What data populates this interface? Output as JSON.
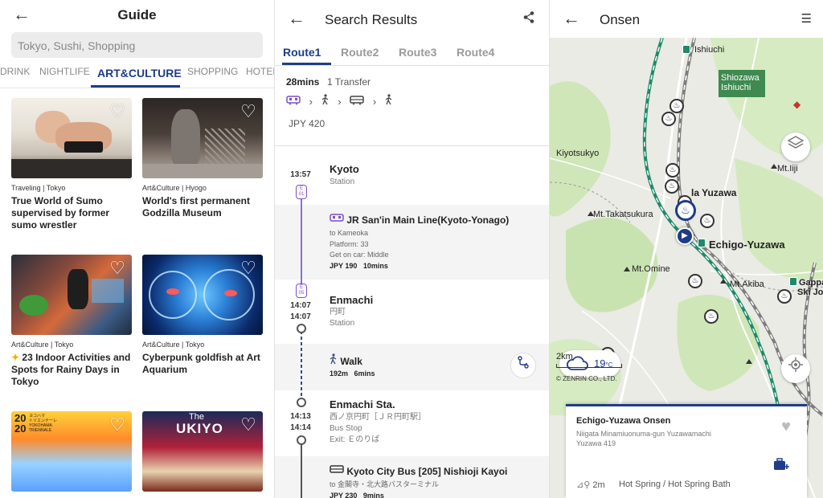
{
  "guide": {
    "title": "Guide",
    "search_placeholder": "Tokyo, Sushi, Shopping",
    "tabs": [
      "DRINK",
      "NIGHTLIFE",
      "ART&CULTURE",
      "SHOPPING",
      "HOTEL"
    ],
    "active_tab": "ART&CULTURE",
    "cards": [
      {
        "category": "Traveling | Tokyo",
        "title": "True World of Sumo supervised by former sumo wrestler"
      },
      {
        "category": "Art&Culture | Hyogo",
        "title": "World's first permanent Godzilla Museum"
      },
      {
        "category": "Art&Culture | Tokyo",
        "title_prefix": "✦",
        "title": "23 Indoor Activities and Spots for Rainy Days in Tokyo"
      },
      {
        "category": "Art&Culture | Tokyo",
        "title": "Cyberpunk goldfish at Art Aquarium"
      }
    ],
    "card_image_text": {
      "triennale": [
        "20",
        "20",
        "ヨコハマ",
        "トリエンナーレ",
        "YOKOHAMA",
        "TRIENNALE"
      ],
      "ukiyo": [
        "The",
        "UKIYO"
      ]
    }
  },
  "search": {
    "title": "Search Results",
    "routes": [
      "Route1",
      "Route2",
      "Route3",
      "Route4"
    ],
    "summary": {
      "duration": "28mins",
      "transfers": "1 Transfer",
      "fare": "JPY 420"
    },
    "stops": [
      {
        "time": "13:57",
        "name": "Kyoto",
        "type": "Station",
        "badge": [
          "E",
          "01"
        ]
      },
      {
        "time_arr": "14:07",
        "time_dep": "14:07",
        "name": "Enmachi",
        "name_jp": "円町",
        "type": "Station",
        "badge": [
          "E",
          "05"
        ]
      },
      {
        "time_arr": "14:13",
        "time_dep": "14:14",
        "name": "Enmachi Sta.",
        "name_jp": "西ノ京円町［ＪＲ円町駅］",
        "type": "Bus Stop",
        "exit": "Exit: Ｅのりば"
      }
    ],
    "segments": [
      {
        "title": "JR San'in Main Line(Kyoto-Yonago)",
        "to": "to Kameoka",
        "platform": "Platform: 33",
        "car": "Get on car: Middle",
        "fare": "JPY 190",
        "duration": "10mins"
      },
      {
        "title": "Walk",
        "distance": "192m",
        "duration": "6mins"
      },
      {
        "title": "Kyoto City Bus [205] Nishioji Kayoi",
        "to": "to 金閣寺・北大路バスターミナル",
        "fare": "JPY 230",
        "duration": "9mins"
      }
    ]
  },
  "map": {
    "title": "Onsen",
    "labels": [
      "Ishiuchi",
      "Shiozawa Ishiuchi",
      "Kiyotsukyo",
      "Mt.Iiji",
      "la Yuzawa",
      "Mt.Takatsukura",
      "Echigo-Yuzawa",
      "Mt.Omine",
      "Mt.Akiba",
      "Gappa",
      "Ski Jo"
    ],
    "temperature": "19",
    "temperature_unit": "°C",
    "scale": "2km",
    "copyright": "© ZENRIN CO., LTD.",
    "card": {
      "name": "Echigo-Yuzawa Onsen",
      "address_line1": "Niigata Minamiuonuma-gun Yuzawamachi",
      "address_line2": "Yuzawa 419",
      "distance": "2m",
      "category": "Hot Spring / Hot Spring Bath"
    }
  },
  "colors": {
    "accent": "#1f3c88",
    "jr_line": "#7b4fc4",
    "map_rail": "#1e8a6a"
  }
}
